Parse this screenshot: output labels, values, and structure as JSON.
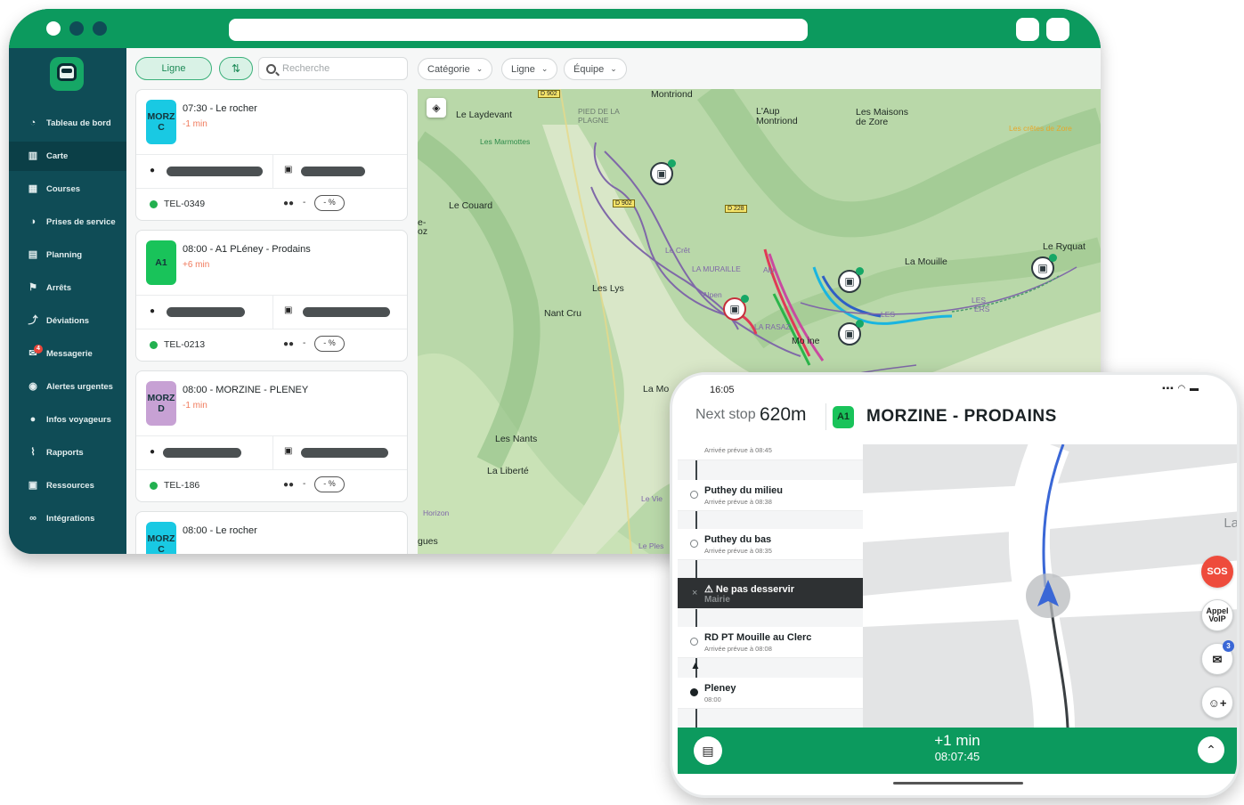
{
  "sidebar": {
    "items": [
      {
        "label": "Tableau de bord",
        "icon": "chart-pie-icon"
      },
      {
        "label": "Carte",
        "icon": "map-icon"
      },
      {
        "label": "Courses",
        "icon": "calendar-icon"
      },
      {
        "label": "Prises de service",
        "icon": "speedometer-icon"
      },
      {
        "label": "Planning",
        "icon": "planning-icon"
      },
      {
        "label": "Arrêts",
        "icon": "stop-flag-icon"
      },
      {
        "label": "Déviations",
        "icon": "deviation-icon"
      },
      {
        "label": "Messagerie",
        "icon": "envelope-icon",
        "badge": "4"
      },
      {
        "label": "Alertes urgentes",
        "icon": "alert-icon"
      },
      {
        "label": "Infos voyageurs",
        "icon": "chat-icon"
      },
      {
        "label": "Rapports",
        "icon": "line-chart-icon"
      },
      {
        "label": "Ressources",
        "icon": "briefcase-icon"
      },
      {
        "label": "Intégrations",
        "icon": "link-icon"
      }
    ]
  },
  "toolbar": {
    "line_toggle": "Ligne",
    "search_placeholder": "Recherche",
    "filters": [
      "Catégorie",
      "Ligne",
      "Équipe"
    ]
  },
  "trips": [
    {
      "line": "MORZ C",
      "line_color": "#19c9e3",
      "title": "07:30 - Le rocher",
      "delay": "-1 min",
      "vehicle": "TEL-0349",
      "dash": "-",
      "pct": "- %"
    },
    {
      "line": "A1",
      "line_color": "#19c35a",
      "title": "08:00 - A1 PLéney - Prodains",
      "delay": "+6 min",
      "vehicle": "TEL-0213",
      "dash": "-",
      "pct": "- %"
    },
    {
      "line": "MORZ D",
      "line_color": "#c7a1d4",
      "title": "08:00 - MORZINE - PLENEY",
      "delay": "-1 min",
      "vehicle": "TEL-186",
      "dash": "-",
      "pct": "- %"
    },
    {
      "line": "MORZ C",
      "line_color": "#19c9e3",
      "title": "08:00 - Le rocher",
      "delay": "",
      "vehicle": "",
      "dash": "",
      "pct": ""
    }
  ],
  "map": {
    "labels": [
      "Montriond",
      "Le Laydevant",
      "PIED DE LA PLAGNE",
      "Les Marmottes",
      "L'Aup Montriond",
      "Les Maisons de Zore",
      "Les crêtes de Zore",
      "Le Couard",
      "La Mouille",
      "Le Ryquat",
      "Les Lys",
      "Nant Cru",
      "Mo   ine",
      "La Mo",
      "Les Nants",
      "La Liberté",
      "gues",
      "Horizon",
      "e- oz",
      "Le Crêt",
      "LA MURAILLE",
      "Alpen",
      "LA RASAZ",
      "LES",
      "LES",
      "Le Ples",
      "Le Vie",
      "ERS",
      "Alp"
    ],
    "roads": [
      "D 902",
      "D 902",
      "D 228"
    ]
  },
  "phone": {
    "time": "16:05",
    "status": "▪▪▪ ◠ ▬",
    "next_stop_label": "Next stop",
    "distance": "620m",
    "line": "A1",
    "route": "MORZINE - PRODAINS",
    "stops": [
      {
        "name": "",
        "time": "Arrivée prévue à 08:45"
      },
      {
        "name": "Puthey du milieu",
        "time": "Arrivée prévue à 08:38"
      },
      {
        "name": "Puthey du bas",
        "time": "Arrivée prévue à 08:35"
      },
      {
        "name": "⚠ Ne pas desservir",
        "time": "Mairie"
      },
      {
        "name": "RD PT Mouille au Clerc",
        "time": "Arrivée prévue à 08:08"
      },
      {
        "name": "Pleney",
        "time": "08:00"
      }
    ],
    "map_label": "La",
    "sos": "SOS",
    "voip": "Appel VoIP",
    "mail_badge": "3",
    "delay": "+1 min",
    "clock": "08:07:45"
  }
}
